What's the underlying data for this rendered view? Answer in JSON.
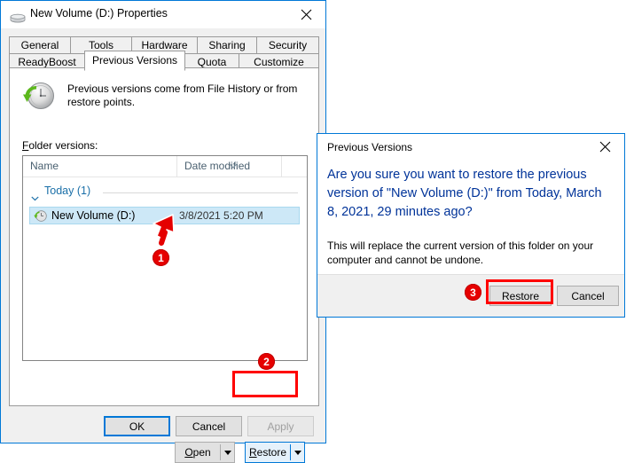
{
  "properties_window": {
    "title": "New Volume (D:) Properties",
    "title_icon": "hard-drive-icon",
    "close_label": "✕",
    "tabs_row1": [
      {
        "label": "General",
        "active": false
      },
      {
        "label": "Tools",
        "active": false
      },
      {
        "label": "Hardware",
        "active": false
      },
      {
        "label": "Sharing",
        "active": false
      },
      {
        "label": "Security",
        "active": false
      }
    ],
    "tabs_row2": [
      {
        "label": "ReadyBoost",
        "active": false
      },
      {
        "label": "Previous Versions",
        "active": true
      },
      {
        "label": "Quota",
        "active": false
      },
      {
        "label": "Customize",
        "active": false
      }
    ],
    "intro_text": "Previous versions come from File History or from restore points.",
    "intro_icon": "restore-clock-icon",
    "folder_versions_label_accel": "F",
    "folder_versions_label_rest": "older versions:",
    "listview": {
      "columns": [
        {
          "label": "Name"
        },
        {
          "label": "Date modified"
        },
        {
          "label": ""
        }
      ],
      "sort_indicator_column": "Date modified",
      "group": {
        "label": "Today (1)",
        "expanded": true
      },
      "rows": [
        {
          "icon": "restore-clock-small-icon",
          "name": "New Volume (D:)",
          "date_modified": "3/8/2021 5:20 PM",
          "selected": true
        }
      ]
    },
    "split_buttons": [
      {
        "accel": "O",
        "rest": "pen",
        "name": "open",
        "highlighted": false
      },
      {
        "accel": "R",
        "rest": "estore",
        "name": "restore",
        "highlighted": true
      }
    ],
    "dialog_buttons": [
      {
        "label": "OK",
        "state": "focused"
      },
      {
        "label": "Cancel",
        "state": "normal"
      },
      {
        "label": "Apply",
        "state": "disabled"
      }
    ]
  },
  "confirm_dialog": {
    "title": "Previous Versions",
    "close_label": "✕",
    "main_instruction": "Are you sure you want to restore the previous version of \"New Volume (D:)\" from Today, March 8, 2021, 29 minutes ago?",
    "body_text": "This will replace the current version of this folder on your computer and cannot be undone.",
    "buttons": [
      {
        "label": "Restore",
        "highlighted": true
      },
      {
        "label": "Cancel",
        "highlighted": false
      }
    ]
  },
  "annotations": {
    "badges": [
      {
        "number": "1",
        "target": "selected-list-row"
      },
      {
        "number": "2",
        "target": "restore-split-button"
      },
      {
        "number": "3",
        "target": "dialog-restore-button"
      }
    ],
    "highlight_color": "#ff0000",
    "badge_color": "#e60000",
    "cursor": "arrow-pointer"
  },
  "colors": {
    "accent": "#0078d7",
    "window_bg": "#f0f0f0",
    "selection": "#cde8f7",
    "instruction_blue": "#003399",
    "column_header": "#4a6070",
    "group_header": "#1a6fa8"
  }
}
